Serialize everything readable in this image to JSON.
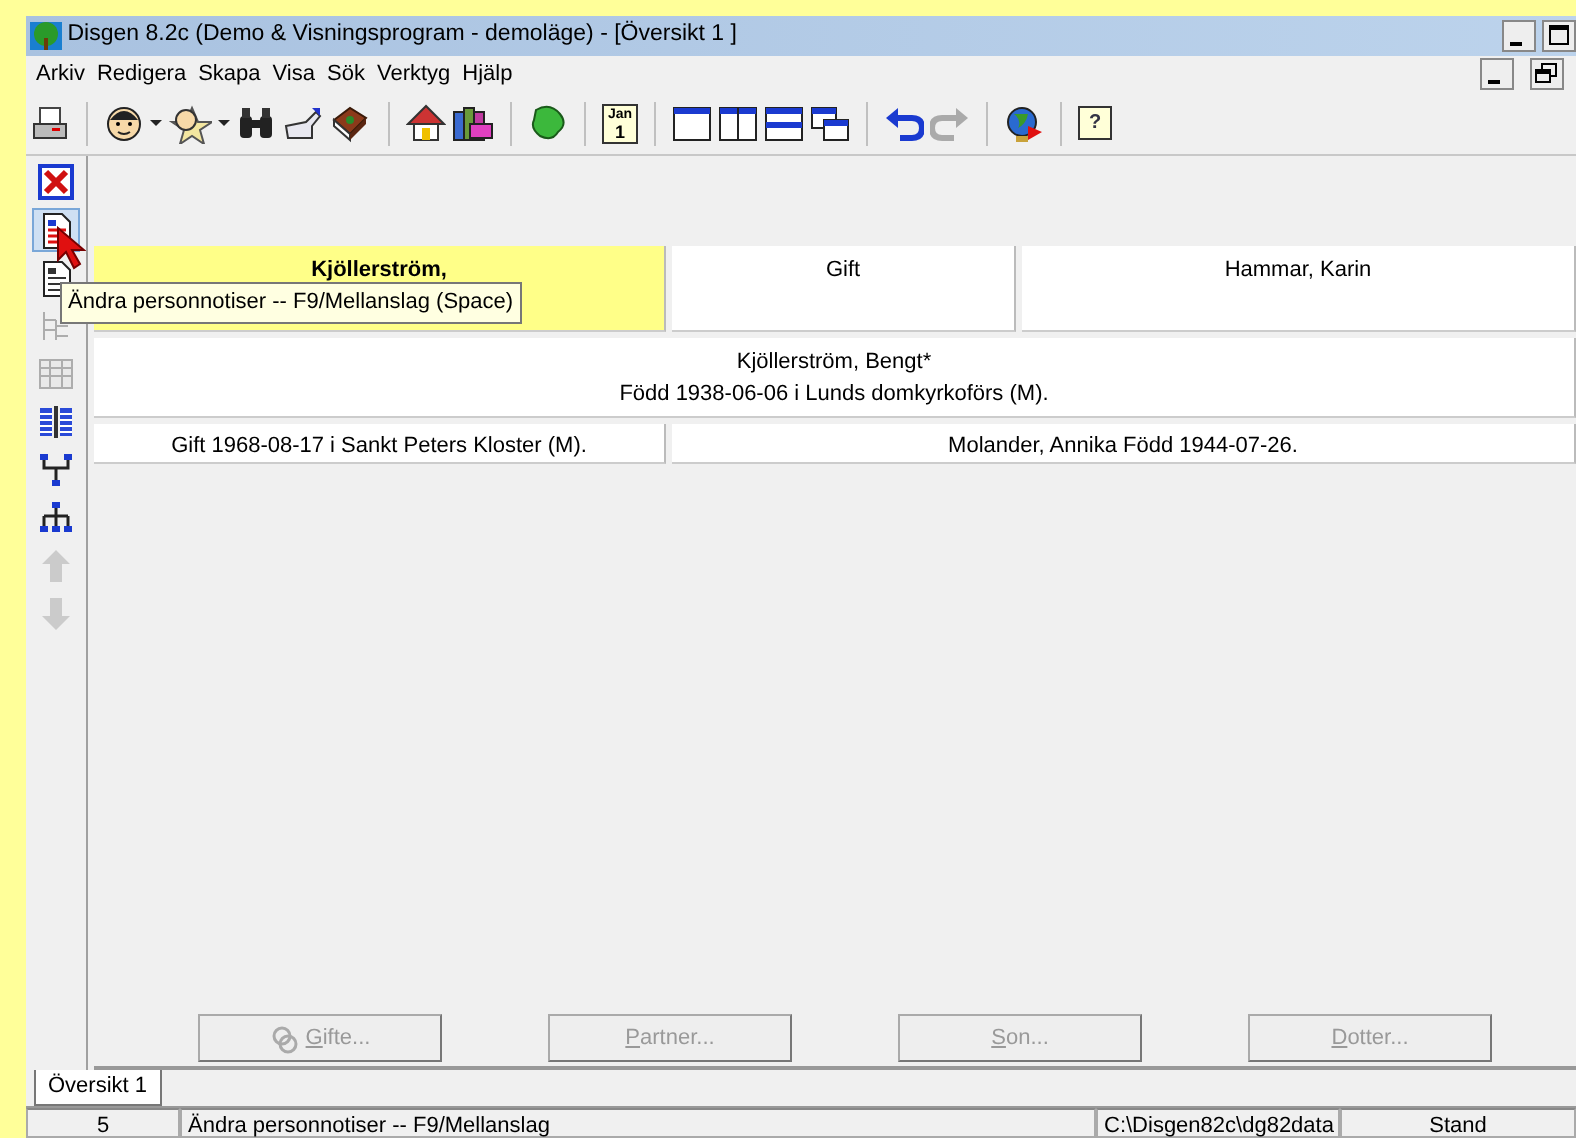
{
  "window": {
    "title": "Disgen 8.2c (Demo & Visningsprogram - demoläge) - [Översikt 1 ]"
  },
  "menu": [
    "Arkiv",
    "Redigera",
    "Skapa",
    "Visa",
    "Sök",
    "Verktyg",
    "Hjälp"
  ],
  "toolbar": [
    {
      "kind": "printer"
    },
    {
      "kind": "sep"
    },
    {
      "kind": "face"
    },
    {
      "kind": "caret"
    },
    {
      "kind": "star-face"
    },
    {
      "kind": "caret"
    },
    {
      "kind": "binoculars"
    },
    {
      "kind": "hand"
    },
    {
      "kind": "book"
    },
    {
      "kind": "sep"
    },
    {
      "kind": "house"
    },
    {
      "kind": "books"
    },
    {
      "kind": "sep"
    },
    {
      "kind": "map"
    },
    {
      "kind": "sep"
    },
    {
      "kind": "calendar",
      "month": "Jan",
      "day": "1"
    },
    {
      "kind": "sep"
    },
    {
      "kind": "win-single"
    },
    {
      "kind": "win-cols"
    },
    {
      "kind": "win-rows"
    },
    {
      "kind": "win-cascade"
    },
    {
      "kind": "sep"
    },
    {
      "kind": "undo",
      "disabled": false
    },
    {
      "kind": "redo",
      "disabled": true
    },
    {
      "kind": "sep"
    },
    {
      "kind": "globe"
    },
    {
      "kind": "sep"
    },
    {
      "kind": "help",
      "glyph": "?"
    }
  ],
  "side_toolbar": [
    {
      "kind": "close",
      "selected": false,
      "disabled": false
    },
    {
      "kind": "notes",
      "selected": true,
      "disabled": false
    },
    {
      "kind": "notes-plain",
      "selected": false,
      "disabled": false
    },
    {
      "kind": "tree",
      "selected": false,
      "disabled": true
    },
    {
      "kind": "grid",
      "selected": false,
      "disabled": true
    },
    {
      "kind": "columns",
      "selected": false,
      "disabled": false
    },
    {
      "kind": "fork",
      "selected": false,
      "disabled": false
    },
    {
      "kind": "org",
      "selected": false,
      "disabled": false
    },
    {
      "kind": "up",
      "selected": false,
      "disabled": true
    },
    {
      "kind": "down",
      "selected": false,
      "disabled": true
    }
  ],
  "family": {
    "row_1": [
      {
        "text": "Kjöllerström,",
        "highlighted": true
      },
      {
        "text": "Gift",
        "highlighted": false
      },
      {
        "text": "Hammar, Karin",
        "highlighted": false
      }
    ],
    "row_2": [
      "Kjöllerström, Bengt*",
      "Född 1938-06-06 i Lunds domkyrkoförs (M)."
    ],
    "row_3": [
      "Gift 1968-08-17 i Sankt Peters Kloster (M).",
      "Molander, Annika Född 1944-07-26."
    ]
  },
  "tooltip": "Ändra personnotiser -- F9/Mellanslag (Space)",
  "buttons": [
    {
      "accel": "G",
      "rest": "ifte...",
      "ring_icon": true,
      "disabled": true
    },
    {
      "accel": "P",
      "rest": "artner...",
      "ring_icon": false,
      "disabled": true
    },
    {
      "accel": "S",
      "rest": "on...",
      "ring_icon": false,
      "disabled": true
    },
    {
      "accel": "D",
      "rest": "otter...",
      "ring_icon": false,
      "disabled": true
    }
  ],
  "tabs": [
    {
      "label": "Översikt 1",
      "selected": true
    }
  ],
  "status_bar": [
    "5",
    "Ändra personnotiser -- F9/Mellanslag",
    "C:\\Disgen82c\\dg82data",
    "Stand"
  ]
}
